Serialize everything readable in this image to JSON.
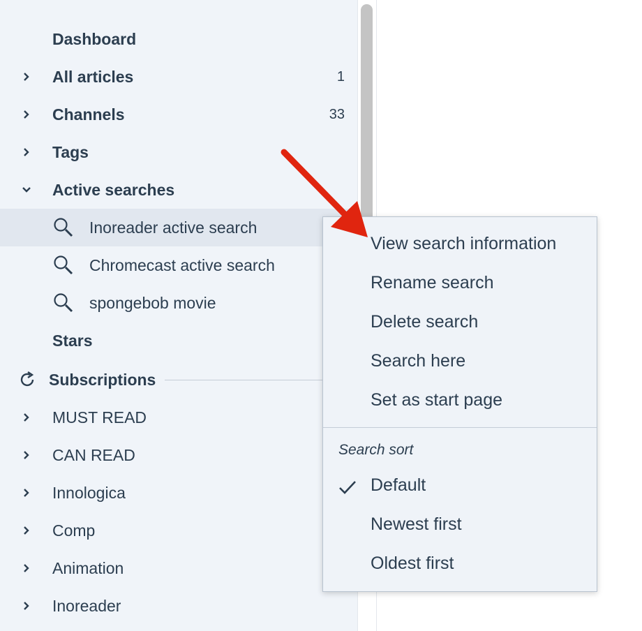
{
  "sidebar": {
    "items": [
      {
        "label": "Dashboard",
        "count": ""
      },
      {
        "label": "All articles",
        "count": "1"
      },
      {
        "label": "Channels",
        "count": "33"
      },
      {
        "label": "Tags",
        "count": ""
      },
      {
        "label": "Active searches",
        "count": ""
      },
      {
        "label": "Stars",
        "count": ""
      }
    ],
    "searches": [
      {
        "label": "Inoreader active search"
      },
      {
        "label": "Chromecast active search"
      },
      {
        "label": "spongebob movie"
      }
    ],
    "subscriptions_label": "Subscriptions",
    "folders": [
      {
        "label": "MUST READ"
      },
      {
        "label": "CAN READ"
      },
      {
        "label": "Innologica"
      },
      {
        "label": "Comp"
      },
      {
        "label": "Animation"
      },
      {
        "label": "Inoreader"
      }
    ]
  },
  "context_menu": {
    "items": [
      {
        "label": "View search information"
      },
      {
        "label": "Rename search"
      },
      {
        "label": "Delete search"
      },
      {
        "label": "Search here"
      },
      {
        "label": "Set as start page"
      }
    ],
    "sort_section": "Search sort",
    "sort_options": [
      {
        "label": "Default",
        "checked": true
      },
      {
        "label": "Newest first",
        "checked": false
      },
      {
        "label": "Oldest first",
        "checked": false
      }
    ]
  },
  "colors": {
    "sidebar_bg": "#f0f4f9",
    "active_row": "#e1e7ef",
    "text": "#2c3e50",
    "arrow": "#e0250f"
  }
}
